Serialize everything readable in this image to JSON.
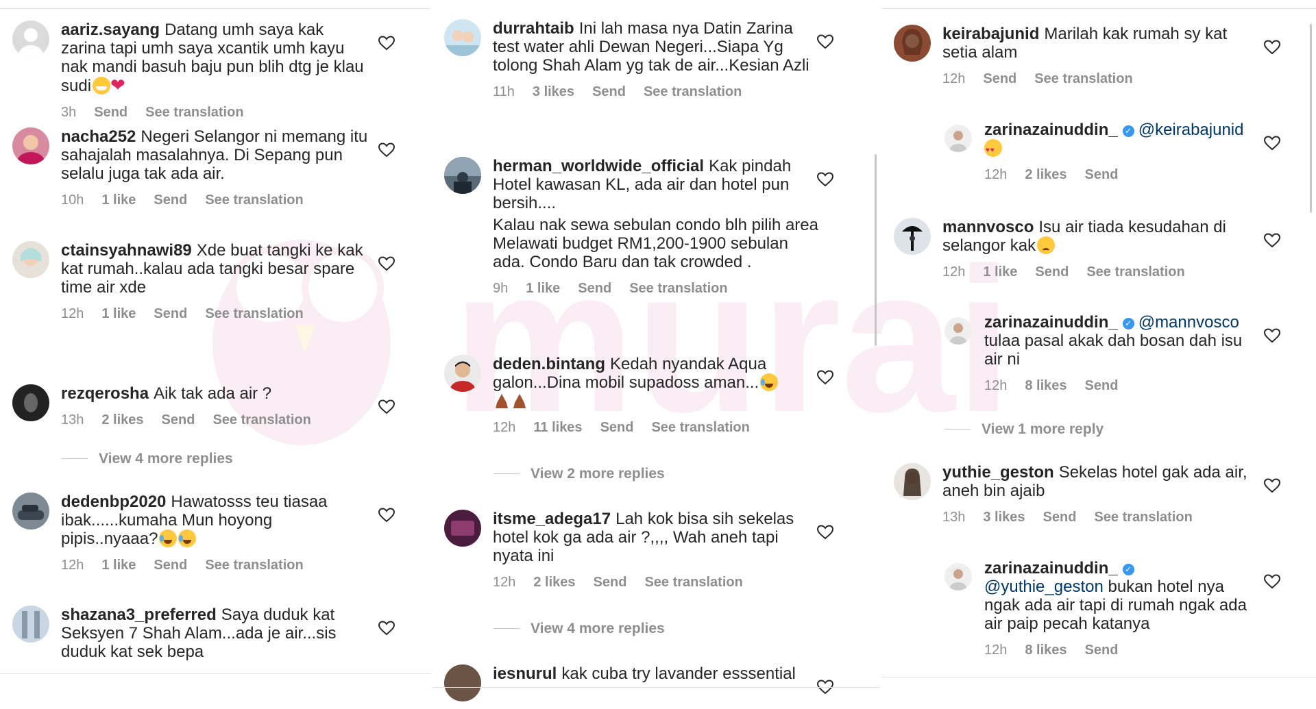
{
  "columns": [
    {
      "comments": [
        {
          "user": "aariz.sayang",
          "text": "Datang umh saya kak zarina tapi umh saya xcantik umh kayu nak mandi basuh baju pun blih dtg je klau sudi",
          "emoji": [
            "grin",
            "heart"
          ],
          "time": "3h",
          "likes": "",
          "send": "Send",
          "translate": "See translation"
        },
        {
          "user": "nacha252",
          "text": "Negeri Selangor ni memang itu sahajalah masalahnya. Di Sepang pun selalu juga tak ada air.",
          "time": "10h",
          "likes": "1 like",
          "send": "Send",
          "translate": "See translation"
        },
        {
          "user": "ctainsyahnawi89",
          "text": "Xde buat tangki ke kak kat rumah..kalau ada tangki besar spare time air xde",
          "time": "12h",
          "likes": "1 like",
          "send": "Send",
          "translate": "See translation"
        },
        {
          "user": "rezqerosha",
          "text": "Aik tak ada air ?",
          "time": "13h",
          "likes": "2 likes",
          "send": "Send",
          "translate": "See translation"
        },
        {
          "user": "dedenbp2020",
          "text": "Hawatosss teu tiasaa ibak......kumaha Mun hoyong pipis..nyaaa?",
          "emoji": [
            "tears",
            "tears"
          ],
          "time": "12h",
          "likes": "1 like",
          "send": "Send",
          "translate": "See translation"
        },
        {
          "user": "shazana3_preferred",
          "text": "Saya duduk kat Seksyen 7 Shah Alam...ada je air...sis duduk kat sek bepa"
        }
      ],
      "more_replies": "View 4 more replies"
    },
    {
      "comments": [
        {
          "user": "durrahtaib",
          "text": "Ini lah masa nya Datin Zarina test water ahli Dewan Negeri...Siapa Yg tolong Shah Alam yg tak de air...Kesian Azli",
          "time": "11h",
          "likes": "3 likes",
          "send": "Send",
          "translate": "See translation"
        },
        {
          "user": "herman_worldwide_official",
          "text": "Kak pindah Hotel kawasan KL, ada air dan hotel pun bersih....",
          "text2": "Kalau nak sewa sebulan condo blh pilih area Melawati budget RM1,200-1900 sebulan ada. Condo Baru dan tak crowded .",
          "time": "9h",
          "likes": "1 like",
          "send": "Send",
          "translate": "See translation"
        },
        {
          "user": "deden.bintang",
          "text": "Kedah nyandak Aqua galon...Dina mobil supadoss aman...",
          "emoji": [
            "tears"
          ],
          "time": "12h",
          "likes": "11 likes",
          "send": "Send",
          "translate": "See translation"
        },
        {
          "user": "itsme_adega17",
          "text": "Lah kok bisa sih sekelas hotel kok ga ada air ?,,,, Wah aneh tapi nyata ini",
          "time": "12h",
          "likes": "2 likes",
          "send": "Send",
          "translate": "See translation"
        },
        {
          "user": "iesnurul",
          "text": "kak cuba try lavander esssential"
        }
      ],
      "more_replies_a": "View 2 more replies",
      "more_replies_b": "View 4 more replies"
    },
    {
      "comments": [
        {
          "user": "keirabajunid",
          "text": "Marilah kak rumah sy kat setia alam",
          "time": "12h",
          "likes": "",
          "send": "Send",
          "translate": "See translation"
        },
        {
          "user": "zarinazainuddin_",
          "mention": "@keirabajunid",
          "text": "",
          "emoji": [
            "hearteyes"
          ],
          "time": "12h",
          "likes": "2 likes",
          "send": "Send"
        },
        {
          "user": "mannvosco",
          "text": "Isu air tiada kesudahan di selangor kak",
          "emoji": [
            "sad"
          ],
          "time": "12h",
          "likes": "1 like",
          "send": "Send",
          "translate": "See translation"
        },
        {
          "user": "zarinazainuddin_",
          "mention": "@mannvosco",
          "text": "tulaa pasal akak dah bosan dah isu air ni",
          "time": "12h",
          "likes": "8 likes",
          "send": "Send"
        },
        {
          "user": "yuthie_geston",
          "text": "Sekelas hotel gak ada air, aneh bin ajaib",
          "time": "13h",
          "likes": "3 likes",
          "send": "Send",
          "translate": "See translation"
        },
        {
          "user": "zarinazainuddin_",
          "mention": "@yuthie_geston",
          "text": "bukan hotel nya ngak ada air tapi di rumah ngak ada air paip pecah katanya",
          "time": "12h",
          "likes": "8 likes",
          "send": "Send"
        }
      ],
      "more_replies": "View 1 more reply"
    }
  ],
  "watermark_text": "murai",
  "colors": {
    "text": "#262626",
    "meta": "#8e8e8e",
    "mention": "#00376b",
    "verified": "#3897f0",
    "watermark": "#e8a0c8"
  },
  "icons": {
    "like": "heart-outline-icon",
    "verified": "verified-badge-icon"
  }
}
